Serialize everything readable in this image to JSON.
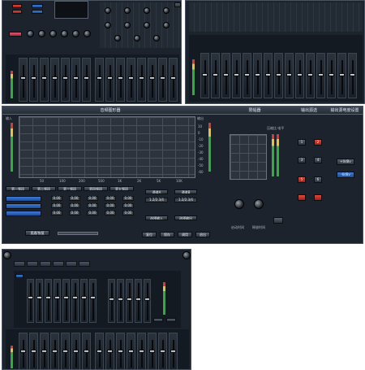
{
  "eq_panel": {
    "section_titles": [
      "音频图形器",
      "限幅器",
      "输出源选",
      "输出源电度设置"
    ],
    "left_axis_label": "输入",
    "right_axis_label": "输出",
    "right_db_ticks": [
      "10",
      "0",
      "-10",
      "-20",
      "-30",
      "-40",
      "-50",
      "-60"
    ],
    "freq_ticks": [
      "50",
      "100",
      "200",
      "500",
      "1K",
      "2K",
      "5K",
      "10K"
    ],
    "band_tabs": [
      "第一频段",
      "第二频段",
      "第三频段",
      "第四频段",
      "第五频段"
    ],
    "bypass_label": "直通/恢复",
    "param_values": [
      "0.00",
      "0.00",
      "0.00",
      "0.00",
      "0.00"
    ],
    "channel_labels": [
      "通道A",
      "通道B"
    ],
    "channel_values": [
      "1.2/2.3/4",
      "1.2/2.3/4"
    ],
    "select_buttons": [
      "选择输入",
      "选择输出"
    ],
    "bottom_buttons": [
      "复位",
      "保存",
      "调用",
      "退出"
    ],
    "limiter_labels": [
      "启动时间",
      "释放时间"
    ],
    "limiter_meter_label": "压缩比 电平",
    "output_source_buttons": [
      "1",
      "2",
      "3",
      "4",
      "5",
      "6"
    ],
    "output_level_buttons": [
      "+0dBv",
      "-6dBv"
    ]
  },
  "colors": {
    "accent_red": "#c8321f",
    "accent_blue": "#2d63b4",
    "panel_bg": "#1c232c"
  }
}
